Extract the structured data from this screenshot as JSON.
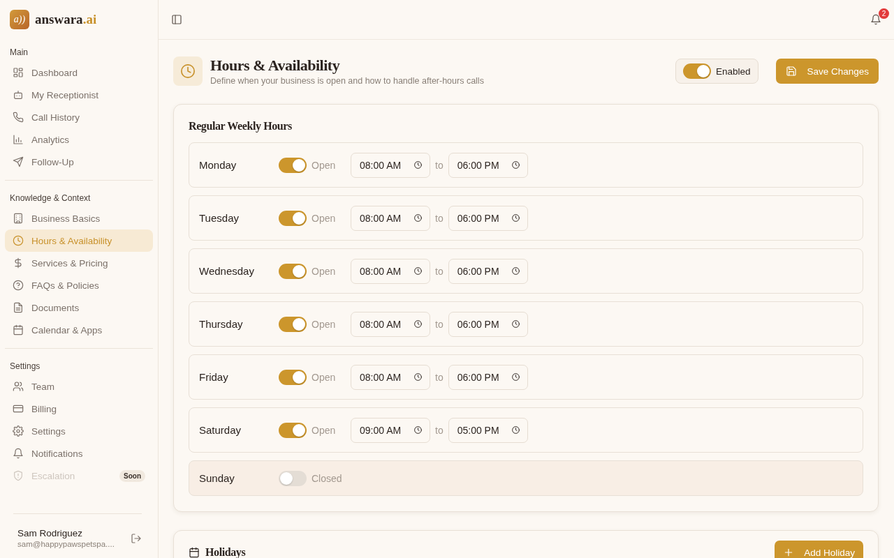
{
  "brand": {
    "mark": "a))",
    "name": "answara",
    "suffix": ".ai"
  },
  "sidebar": {
    "sections": [
      {
        "title": "Main",
        "items": [
          {
            "label": "Dashboard",
            "selected": false,
            "disabled": false
          },
          {
            "label": "My Receptionist",
            "selected": false,
            "disabled": false
          },
          {
            "label": "Call History",
            "selected": false,
            "disabled": false
          },
          {
            "label": "Analytics",
            "selected": false,
            "disabled": false
          },
          {
            "label": "Follow-Up",
            "selected": false,
            "disabled": false
          }
        ]
      },
      {
        "title": "Knowledge & Context",
        "items": [
          {
            "label": "Business Basics",
            "selected": false,
            "disabled": false
          },
          {
            "label": "Hours & Availability",
            "selected": true,
            "disabled": false
          },
          {
            "label": "Services & Pricing",
            "selected": false,
            "disabled": false
          },
          {
            "label": "FAQs & Policies",
            "selected": false,
            "disabled": false
          },
          {
            "label": "Documents",
            "selected": false,
            "disabled": false
          },
          {
            "label": "Calendar & Apps",
            "selected": false,
            "disabled": false
          }
        ]
      },
      {
        "title": "Settings",
        "items": [
          {
            "label": "Team",
            "selected": false,
            "disabled": false
          },
          {
            "label": "Billing",
            "selected": false,
            "disabled": false
          },
          {
            "label": "Settings",
            "selected": false,
            "disabled": false
          },
          {
            "label": "Notifications",
            "selected": false,
            "disabled": false
          },
          {
            "label": "Escalation",
            "selected": false,
            "disabled": true,
            "badge": "Soon"
          }
        ]
      }
    ],
    "user": {
      "name": "Sam Rodriguez",
      "email": "sam@happypawspetspa...."
    }
  },
  "topbar": {
    "notification_count": "2"
  },
  "header": {
    "title": "Hours & Availability",
    "subtitle": "Define when your business is open and how to handle after-hours calls",
    "enabled_toggle": {
      "label": "Enabled",
      "on": true
    },
    "save_button": "Save Changes"
  },
  "weekly_hours": {
    "title": "Regular Weekly Hours",
    "days": [
      {
        "day": "Monday",
        "open": true,
        "status": "Open",
        "from": "08:00 AM",
        "separator": "to",
        "to": "06:00 PM"
      },
      {
        "day": "Tuesday",
        "open": true,
        "status": "Open",
        "from": "08:00 AM",
        "separator": "to",
        "to": "06:00 PM"
      },
      {
        "day": "Wednesday",
        "open": true,
        "status": "Open",
        "from": "08:00 AM",
        "separator": "to",
        "to": "06:00 PM"
      },
      {
        "day": "Thursday",
        "open": true,
        "status": "Open",
        "from": "08:00 AM",
        "separator": "to",
        "to": "06:00 PM"
      },
      {
        "day": "Friday",
        "open": true,
        "status": "Open",
        "from": "08:00 AM",
        "separator": "to",
        "to": "06:00 PM"
      },
      {
        "day": "Saturday",
        "open": true,
        "status": "Open",
        "from": "09:00 AM",
        "separator": "to",
        "to": "05:00 PM"
      },
      {
        "day": "Sunday",
        "open": false,
        "status": "Closed"
      }
    ]
  },
  "holidays": {
    "title": "Holidays",
    "add_button": "Add Holiday"
  }
}
